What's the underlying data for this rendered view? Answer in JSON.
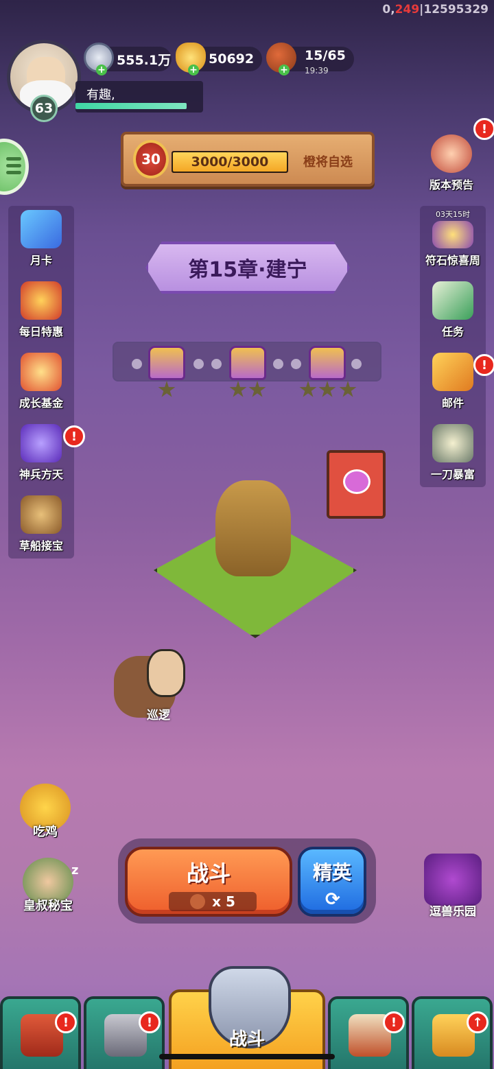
{
  "debug": {
    "a": "0,",
    "b": "249",
    "c": "|12595329"
  },
  "player": {
    "level": "63",
    "name": "有趣,",
    "xp_fraction": 0.9
  },
  "resources": {
    "silver": "555.1万",
    "gold": "50692",
    "stamina": "15/65",
    "stamina_timer": "19:39",
    "plus": "+"
  },
  "banner": {
    "rank": "30",
    "progress_text": "3000/3000",
    "progress_fraction": 1.0,
    "action": "橙将自选"
  },
  "chapter": {
    "title": "第15章·建宁"
  },
  "left_menu": [
    {
      "label": "月卡",
      "icon": "monthly-card-icon"
    },
    {
      "label": "每日特惠",
      "icon": "daily-deal-icon"
    },
    {
      "label": "成长基金",
      "icon": "growth-fund-icon"
    },
    {
      "label": "神兵方天",
      "icon": "divine-weapon-icon"
    },
    {
      "label": "草船接宝",
      "icon": "straw-boat-icon"
    }
  ],
  "right_menu": [
    {
      "label": "版本预告",
      "icon": "version-preview-icon"
    },
    {
      "label": "符石惊喜周",
      "icon": "rune-week-icon",
      "timer": "03天15时"
    },
    {
      "label": "任务",
      "icon": "quest-scroll-icon"
    },
    {
      "label": "邮件",
      "icon": "mail-icon"
    },
    {
      "label": "一刀暴富",
      "icon": "fortune-slash-icon"
    }
  ],
  "alert_mark": "!",
  "chest_stars": [
    1,
    2,
    3
  ],
  "patrol": {
    "label": "巡逻"
  },
  "bottom_left": {
    "chicken": "吃鸡",
    "uncle_treasure": "皇叔秘宝",
    "sleep": "z"
  },
  "battle": {
    "label": "战斗",
    "cost": "x 5",
    "elite_label": "精英",
    "elite_refresh": "⟳"
  },
  "pet_park": {
    "label": "逗兽乐园"
  },
  "nav": {
    "center_label": "战斗",
    "upgrade_arrow": "↑"
  },
  "colors": {
    "accent_green": "#3fd6a4",
    "alert_red": "#e8281e",
    "fight_orange": "#ee5e2c",
    "elite_blue": "#1e6ae0"
  }
}
